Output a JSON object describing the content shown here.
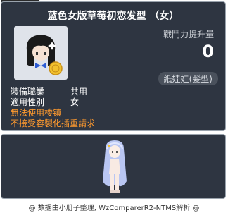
{
  "item": {
    "id": "00038075",
    "title": "蓝色女版草莓初恋发型 （女）",
    "power_label": "戰鬥力提升量",
    "power_value": "0",
    "category": "紙娃娃(髮型)"
  },
  "info": {
    "rows": [
      {
        "label": "裝備職業",
        "value": "共用"
      },
      {
        "label": "適用性別",
        "value": "女"
      }
    ],
    "warnings": [
      "無法使用楼镇",
      "不接受容製化插重請求"
    ]
  },
  "footer": {
    "text": "@ 数据由小册子整理, WzComparerR2-NTMS解析 @"
  },
  "colors": {
    "panel_bg": "#2e3541",
    "warning": "#ff9a2e",
    "hair": "#b9c6f2"
  }
}
